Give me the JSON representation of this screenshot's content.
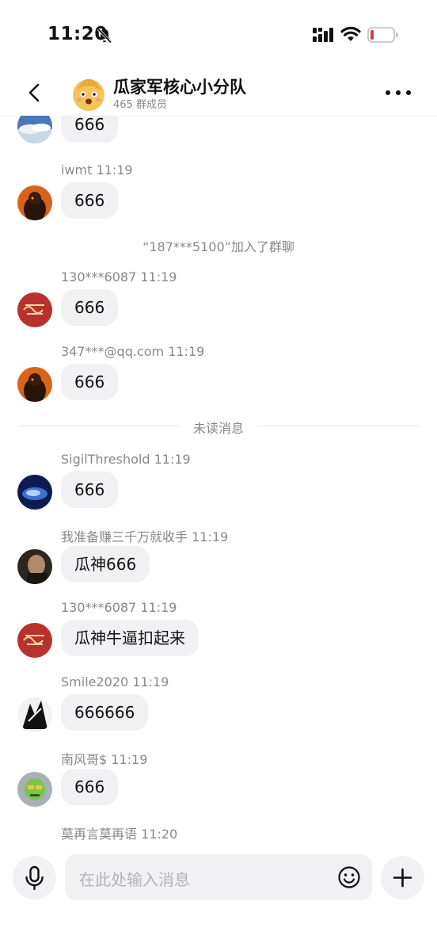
{
  "status_bar": {
    "time": "11:20"
  },
  "header": {
    "group_name": "瓜家军核心小分队",
    "member_count": "465 群成员"
  },
  "messages": [
    {
      "sender": "",
      "text": "666"
    },
    {
      "sender": "iwmt  11:19",
      "text": "666"
    },
    {
      "sender": "130***6087  11:19",
      "text": "666"
    },
    {
      "sender": "347***@qq.com  11:19",
      "text": "666"
    },
    {
      "sender": "SigilThreshold  11:19",
      "text": "666"
    },
    {
      "sender": "我准备赚三千万就收手  11:19",
      "text": "瓜神666"
    },
    {
      "sender": "130***6087  11:19",
      "text": "瓜神牛逼扣起来"
    },
    {
      "sender": "Smile2020  11:19",
      "text": "666666"
    },
    {
      "sender": "南风哥$  11:19",
      "text": "666"
    },
    {
      "sender": "莫再言莫再语  11:20",
      "text": ""
    }
  ],
  "system_message": "“187***5100”加入了群聊",
  "unread_divider": "未读消息",
  "input": {
    "placeholder": "在此处输入消息"
  },
  "icons": {
    "bell": "bell-muted-icon",
    "signal": "signal-icon",
    "wifi": "wifi-icon",
    "battery": "battery-low-icon",
    "back": "back-arrow-icon",
    "more": "more-icon",
    "mic": "microphone-icon",
    "emoji": "emoji-icon",
    "plus": "plus-icon"
  },
  "colors": {
    "bubble": "#f1f1f3",
    "secondary_text": "#888888",
    "battery_low": "#e03b3b"
  }
}
